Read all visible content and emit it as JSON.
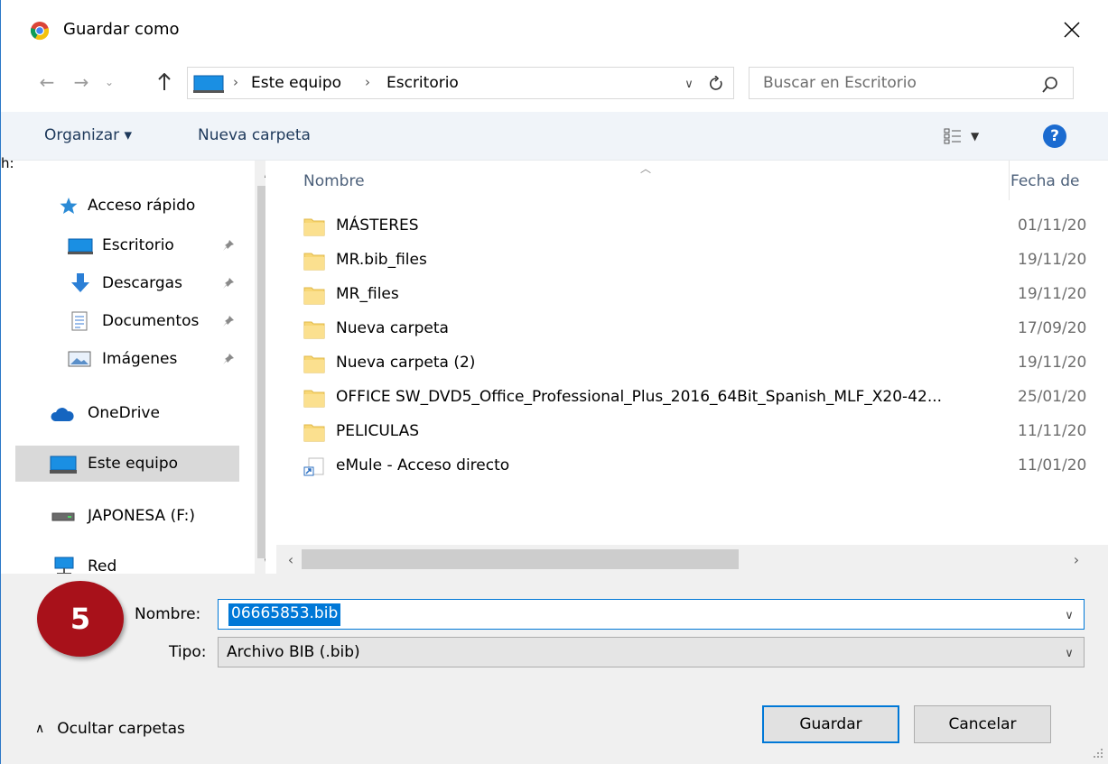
{
  "window": {
    "title": "Guardar como",
    "close_symbol": "✕"
  },
  "address_bar": {
    "crumbs": [
      "Este equipo",
      "Escritorio"
    ],
    "separator": "›"
  },
  "search": {
    "placeholder": "Buscar en Escritorio"
  },
  "toolbar": {
    "organize_label": "Organizar ▾",
    "new_folder_label": "Nueva carpeta",
    "help_label": "?"
  },
  "edge_fragment": "h:",
  "nav_pane": {
    "items": [
      {
        "label": "Acceso rápido",
        "icon": "star-icon"
      },
      {
        "label": "Escritorio",
        "icon": "desktop-icon",
        "pinned": true
      },
      {
        "label": "Descargas",
        "icon": "download-icon",
        "pinned": true
      },
      {
        "label": "Documentos",
        "icon": "document-icon",
        "pinned": true
      },
      {
        "label": "Imágenes",
        "icon": "pictures-icon",
        "pinned": true
      },
      {
        "label": "OneDrive",
        "icon": "cloud-icon"
      },
      {
        "label": "Este equipo",
        "icon": "computer-icon",
        "selected": true
      },
      {
        "label": "JAPONESA (F:)",
        "icon": "drive-icon"
      },
      {
        "label": "Red",
        "icon": "network-icon"
      }
    ]
  },
  "file_list": {
    "columns": {
      "name": "Nombre",
      "date": "Fecha de"
    },
    "rows": [
      {
        "name": "MÁSTERES",
        "date": "01/11/20",
        "type": "folder"
      },
      {
        "name": "MR.bib_files",
        "date": "19/11/20",
        "type": "folder"
      },
      {
        "name": "MR_files",
        "date": "19/11/20",
        "type": "folder"
      },
      {
        "name": "Nueva carpeta",
        "date": "17/09/20",
        "type": "folder"
      },
      {
        "name": "Nueva carpeta (2)",
        "date": "19/11/20",
        "type": "folder"
      },
      {
        "name": "OFFICE SW_DVD5_Office_Professional_Plus_2016_64Bit_Spanish_MLF_X20-42...",
        "date": "25/01/20",
        "type": "folder"
      },
      {
        "name": "PELICULAS",
        "date": "11/11/20",
        "type": "folder"
      },
      {
        "name": "eMule - Acceso directo",
        "date": "11/01/20",
        "type": "shortcut"
      }
    ]
  },
  "form": {
    "step_badge": "5",
    "name_label": "Nombre:",
    "name_value": "06665853.bib",
    "type_label": "Tipo:",
    "type_value": "Archivo BIB (.bib)",
    "hide_folders_label": "Ocultar carpetas",
    "save_label": "Guardar",
    "cancel_label": "Cancelar"
  },
  "colors": {
    "accent": "#0078d7",
    "badge": "#a8111a",
    "folder": "#f8d775"
  }
}
